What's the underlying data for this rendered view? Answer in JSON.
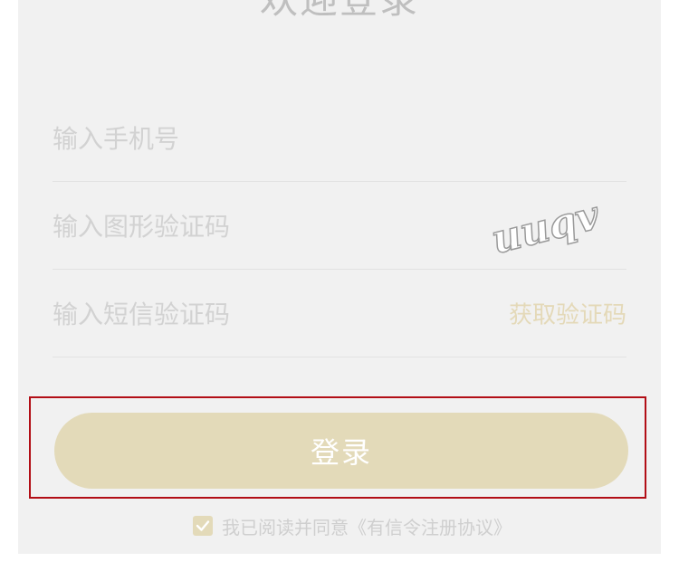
{
  "header": {
    "title": "欢迎登录"
  },
  "form": {
    "phone_placeholder": "输入手机号",
    "captcha_placeholder": "输入图形验证码",
    "captcha_text": "uuqv",
    "sms_placeholder": "输入短信验证码",
    "get_code_label": "获取验证码",
    "login_label": "登录"
  },
  "agreement": {
    "checked": true,
    "text": "我已阅读并同意《有信令注册协议》"
  },
  "colors": {
    "accent": "#e3dab9",
    "highlight_border": "#b20e16",
    "panel_bg": "#f1f1f1"
  }
}
